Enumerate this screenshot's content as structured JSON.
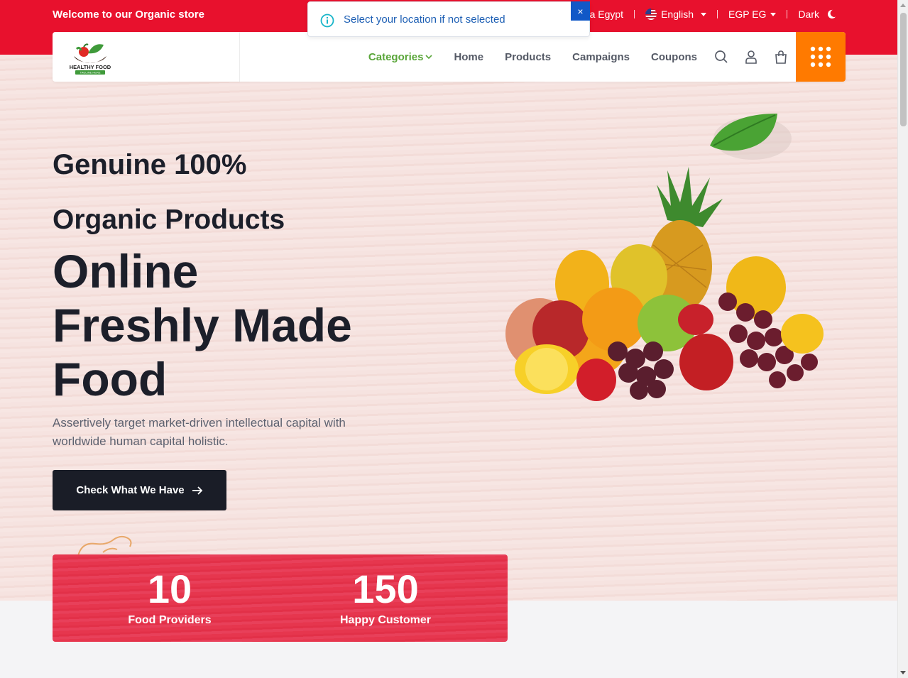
{
  "topbar": {
    "welcome": "Welcome to our Organic store",
    "location": "dria Egypt",
    "language": "English",
    "currency": "EGP EG",
    "theme": "Dark"
  },
  "toast": {
    "message": "Select your location if not selected",
    "close": "×"
  },
  "logo": {
    "brand": "HEALTHY FOOD",
    "tagline": "TAGLINE HERE"
  },
  "nav": {
    "categories": "Categories",
    "home": "Home",
    "products": "Products",
    "campaigns": "Campaigns",
    "coupons": "Coupons"
  },
  "hero": {
    "line1": "Genuine 100%",
    "line2": "Organic Products",
    "big1": "Online",
    "big2": "Freshly Made",
    "big3": "Food",
    "description": "Assertively target market-driven intellectual capital with worldwide human capital holistic.",
    "cta": "Check What We Have"
  },
  "stats": [
    {
      "value": "10",
      "label": "Food Providers"
    },
    {
      "value": "150",
      "label": "Happy Customer"
    }
  ],
  "colors": {
    "topbar": "#e8112d",
    "accent_green": "#5aa63a",
    "menu_button": "#ff7a00",
    "cta": "#1a1d27",
    "stats": "#e6364e"
  }
}
